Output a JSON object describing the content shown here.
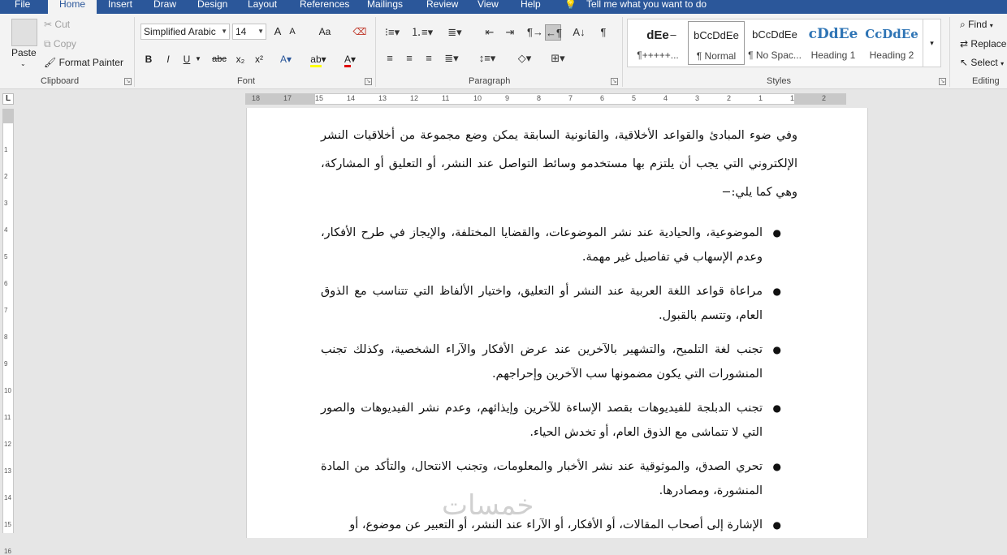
{
  "tabs": [
    "File",
    "Home",
    "Insert",
    "Draw",
    "Design",
    "Layout",
    "References",
    "Mailings",
    "Review",
    "View",
    "Help"
  ],
  "tell_me": "Tell me what you want to do",
  "clipboard": {
    "paste": "Paste",
    "cut": "Cut",
    "copy": "Copy",
    "format_painter": "Format Painter",
    "label": "Clipboard"
  },
  "font": {
    "name": "Simplified Arabic",
    "size": "14",
    "label": "Font",
    "buttons": {
      "bold": "B",
      "italic": "I",
      "underline": "U",
      "strike": "abc",
      "subscript": "x₂",
      "superscript": "x²",
      "grow": "A",
      "shrink": "A",
      "case": "Aa"
    }
  },
  "paragraph": {
    "label": "Paragraph"
  },
  "styles": {
    "label": "Styles",
    "items": [
      {
        "preview": "dEe",
        "name": "¶+++++..."
      },
      {
        "preview": "bCcDdEe",
        "name": "¶ Normal"
      },
      {
        "preview": "bCcDdEe",
        "name": "¶ No Spac..."
      },
      {
        "preview": "cDdEe",
        "name": "Heading 1"
      },
      {
        "preview": "CcDdEe",
        "name": "Heading 2"
      }
    ]
  },
  "editing": {
    "find": "Find",
    "replace": "Replace",
    "select": "Select",
    "label": "Editing"
  },
  "ruler": {
    "h_ticks": [
      "18",
      "17",
      "15",
      "14",
      "13",
      "12",
      "11",
      "10",
      "9",
      "8",
      "7",
      "6",
      "5",
      "4",
      "3",
      "2",
      "1",
      "1",
      "2"
    ],
    "v_ticks": [
      "1",
      "2",
      "3",
      "4",
      "5",
      "6",
      "7",
      "8",
      "9",
      "10",
      "11",
      "12",
      "13",
      "14",
      "15",
      "16"
    ]
  },
  "document": {
    "intro": "وفي ضوء المبادئ والقواعد الأخلاقية، والقانونية السابقة يمكن وضع مجموعة من أخلاقيات النشر الإلكتروني التي يجب أن يلتزم بها مستخدمو وسائط التواصل عند النشر، أو التعليق أو المشاركة، وهي كما يلي:−",
    "bullets": [
      "الموضوعية، والحيادية عند نشر الموضوعات، والقضايا المختلفة، والإيجاز في طرح الأفكار، وعدم الإسهاب في تفاصيل غير مهمة.",
      "مراعاة قواعد اللغة العربية عند النشر أو التعليق، واختيار الألفاظ التي تتناسب مع الذوق العام، وتتسم بالقبول.",
      "تجنب لغة التلميح، والتشهير بالآخرين عند عرض الأفكار والآراء الشخصية، وكذلك تجنب المنشورات التي يكون مضمونها سب الآخرين وإحراجهم.",
      "تجنب الدبلجة للفيديوهات بقصد الإساءة للآخرين وإيذائهم، وعدم نشر الفيديوهات والصور التي لا تتماشى مع الذوق العام، أو تخدش الحياء.",
      "تحري الصدق، والموثوقية عند نشر الأخبار والمعلومات، وتجنب الانتحال، والتأكد من المادة المنشورة، ومصادرها.",
      "الإشارة إلى أصحاب المقالات، أو الأفكار، أو الآراء عند النشر، أو التعبير عن موضوع، أو"
    ],
    "bullet_char": "●",
    "watermark": "خمسات"
  }
}
